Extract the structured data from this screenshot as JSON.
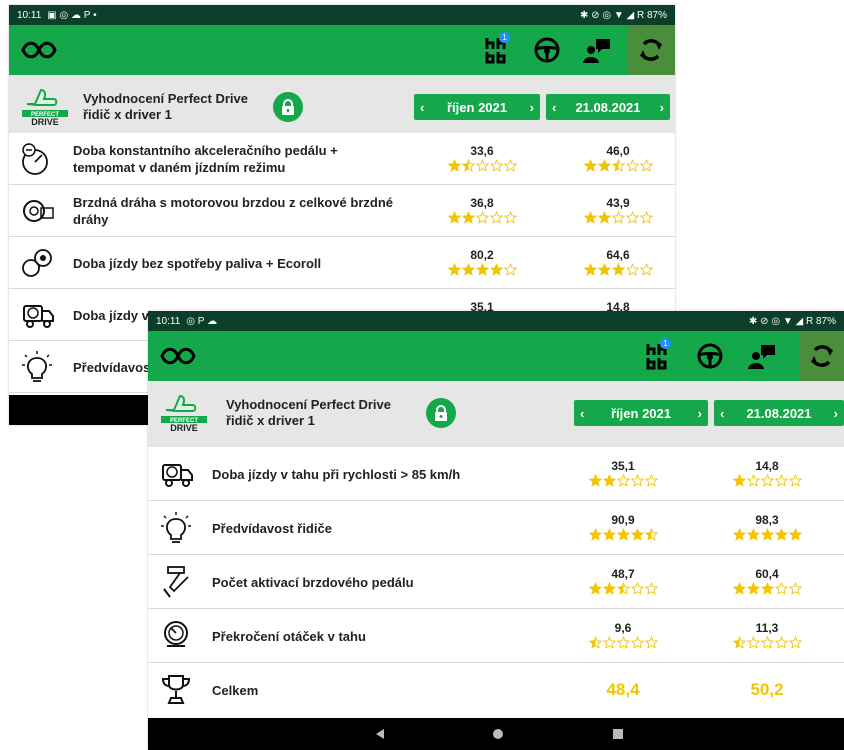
{
  "back_screen": {
    "status": {
      "time": "10:11",
      "right": "✱ ⊘ ◎ ▼ ◢ R 87%"
    },
    "appbar": {
      "badge": "1"
    },
    "header": {
      "title_line1": "Vyhodnocení Perfect Drive",
      "title_line2": "řidič x driver 1",
      "period1": "říjen 2021",
      "period2": "21.08.2021",
      "prev_symbol": "‹",
      "next_symbol": "›"
    },
    "rows": [
      {
        "line1": "Doba konstantního akceleračního pedálu +",
        "line2": "tempomat v daném jízdním režimu",
        "v1": "33,6",
        "r1": 1.5,
        "v2": "46,0",
        "r2": 2.5,
        "icon": "speedometer-icon"
      },
      {
        "line1": "Brzdná dráha s motorovou brzdou z celkové brzdné",
        "line2": "dráhy",
        "v1": "36,8",
        "r1": 2,
        "v2": "43,9",
        "r2": 2,
        "icon": "engine-brake-icon"
      },
      {
        "line1": "Doba jízdy bez spotřeby paliva + Ecoroll",
        "line2": "",
        "v1": "80,2",
        "r1": 4,
        "v2": "64,6",
        "r2": 3,
        "icon": "ecoroll-icon"
      },
      {
        "line1": "Doba jízdy v",
        "line2": "",
        "v1": "35,1",
        "r1": 2,
        "v2": "14,8",
        "r2": 1,
        "icon": "truck-speed-icon"
      },
      {
        "line1": "Předvídavos",
        "line2": "",
        "v1": "",
        "r1": 0,
        "v2": "",
        "r2": 0,
        "icon": "lightbulb-icon"
      }
    ]
  },
  "front_screen": {
    "status": {
      "time": "10:11",
      "right": "✱ ⊘ ◎ ▼ ◢ R 87%"
    },
    "appbar": {
      "badge": "1"
    },
    "header": {
      "title_line1": "Vyhodnocení Perfect Drive",
      "title_line2": "řidič x driver 1",
      "period1": "říjen 2021",
      "period2": "21.08.2021",
      "prev_symbol": "‹",
      "next_symbol": "›"
    },
    "rows": [
      {
        "line1": "Doba jízdy v tahu při rychlosti > 85 km/h",
        "line2": "",
        "v1": "35,1",
        "r1": 2,
        "v2": "14,8",
        "r2": 1,
        "icon": "truck-speed-icon"
      },
      {
        "line1": "Předvídavost řidiče",
        "line2": "",
        "v1": "90,9",
        "r1": 4.5,
        "v2": "98,3",
        "r2": 5,
        "icon": "lightbulb-icon"
      },
      {
        "line1": "Počet aktivací brzdového pedálu",
        "line2": "",
        "v1": "48,7",
        "r1": 2.5,
        "v2": "60,4",
        "r2": 3,
        "icon": "brake-pedal-icon"
      },
      {
        "line1": "Překročení otáček v tahu",
        "line2": "",
        "v1": "9,6",
        "r1": 0.5,
        "v2": "11,3",
        "r2": 0.5,
        "icon": "rpm-icon"
      }
    ],
    "total": {
      "label": "Celkem",
      "v1": "48,4",
      "v2": "50,2",
      "icon": "trophy-icon"
    }
  },
  "colors": {
    "green": "#14a84a",
    "dark_green": "#0b3f2a",
    "star": "#f3c500",
    "refresh_bg": "#4a8d3a"
  }
}
